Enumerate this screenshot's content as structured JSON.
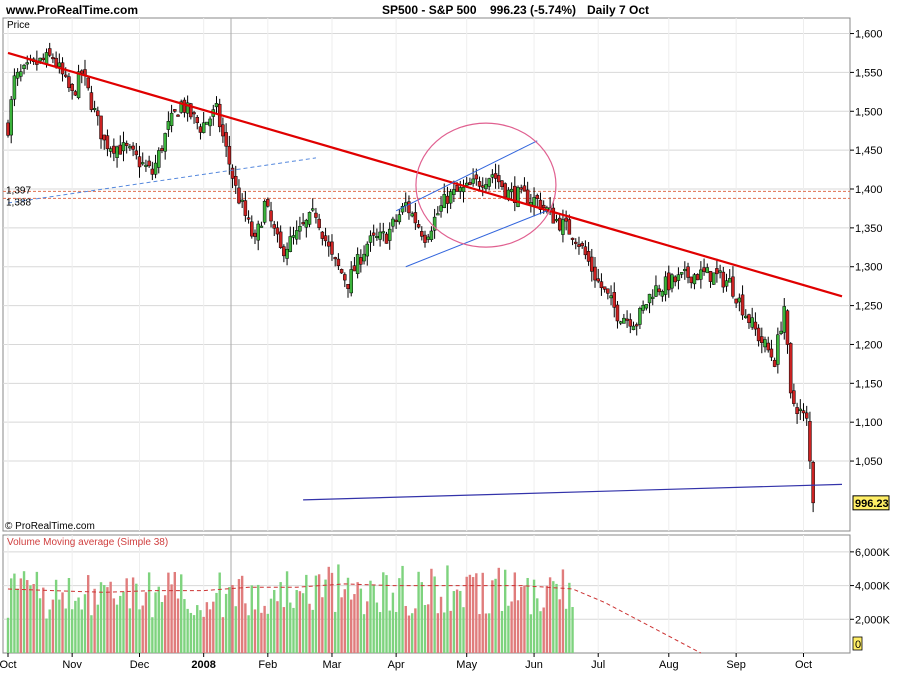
{
  "header": {
    "site": "www.ProRealTime.com",
    "title": "SP500 - S&P 500",
    "last": "996.23 (-5.74%)",
    "period": "Daily  7 Oct"
  },
  "price_panel": {
    "label": "Price",
    "copyright": "© ProRealTime.com",
    "last_price_tag": "996.23",
    "hline_labels": [
      "1,397",
      "1,388"
    ]
  },
  "volume_panel": {
    "label": "Volume Moving average (Simple 38)"
  },
  "colors": {
    "up": "#3bb33b",
    "down": "#cc2222",
    "vol_up": "#7ed37e",
    "vol_down": "#e07c7c",
    "trend_red": "#e00000",
    "channel_blue": "#3366dd",
    "support_blue": "#3333aa",
    "circle": "#e06090",
    "grid": "#d8d8d8",
    "hline": "#e07050",
    "tag_bg": "#ffee66"
  },
  "chart_data": {
    "type": "candlestick",
    "title": "SP500 - S&P 500",
    "ylim": [
      960,
      1620
    ],
    "y_ticks": [
      1050,
      1100,
      1150,
      1200,
      1250,
      1300,
      1350,
      1400,
      1450,
      1500,
      1550,
      1600
    ],
    "y_tick_labels": [
      "1,050",
      "1,100",
      "1,150",
      "1,200",
      "1,250",
      "1,300",
      "1,350",
      "1,400",
      "1,450",
      "1,500",
      "1,550",
      "1,600"
    ],
    "x_labels": [
      "Oct",
      "Nov",
      "Dec",
      "2008",
      "Feb",
      "Mar",
      "Apr",
      "May",
      "Jun",
      "Jul",
      "Aug",
      "Sep",
      "Oct"
    ],
    "x_label_days": [
      0,
      20,
      41,
      61,
      81,
      101,
      121,
      143,
      164,
      184,
      206,
      227,
      248
    ],
    "total_days": 260,
    "close_anchors": [
      [
        0,
        1480
      ],
      [
        2,
        1540
      ],
      [
        8,
        1560
      ],
      [
        14,
        1570
      ],
      [
        20,
        1520
      ],
      [
        23,
        1550
      ],
      [
        30,
        1460
      ],
      [
        37,
        1450
      ],
      [
        45,
        1420
      ],
      [
        50,
        1480
      ],
      [
        54,
        1510
      ],
      [
        60,
        1480
      ],
      [
        65,
        1500
      ],
      [
        71,
        1400
      ],
      [
        77,
        1330
      ],
      [
        80,
        1380
      ],
      [
        85,
        1320
      ],
      [
        90,
        1340
      ],
      [
        96,
        1370
      ],
      [
        101,
        1310
      ],
      [
        106,
        1280
      ],
      [
        112,
        1330
      ],
      [
        118,
        1340
      ],
      [
        124,
        1380
      ],
      [
        130,
        1340
      ],
      [
        137,
        1390
      ],
      [
        143,
        1400
      ],
      [
        151,
        1420
      ],
      [
        156,
        1395
      ],
      [
        161,
        1390
      ],
      [
        165,
        1385
      ],
      [
        171,
        1360
      ],
      [
        177,
        1340
      ],
      [
        184,
        1280
      ],
      [
        190,
        1240
      ],
      [
        196,
        1230
      ],
      [
        201,
        1270
      ],
      [
        207,
        1280
      ],
      [
        213,
        1290
      ],
      [
        219,
        1290
      ],
      [
        225,
        1280
      ],
      [
        230,
        1240
      ],
      [
        234,
        1210
      ],
      [
        239,
        1180
      ],
      [
        242,
        1250
      ],
      [
        244,
        1130
      ],
      [
        246,
        1120
      ],
      [
        249,
        1100
      ],
      [
        251,
        996
      ]
    ],
    "last_close": 996.23,
    "annotations": {
      "resistance_line": [
        [
          0,
          1575
        ],
        [
          260,
          1262
        ]
      ],
      "support_line": [
        [
          92,
          1000
        ],
        [
          260,
          1020
        ]
      ],
      "channel_upper": [
        [
          121,
          1372
        ],
        [
          165,
          1462
        ]
      ],
      "channel_lower": [
        [
          124,
          1300
        ],
        [
          168,
          1372
        ]
      ],
      "dashed_trend": [
        [
          0,
          1382
        ],
        [
          96,
          1440
        ]
      ],
      "hlines": [
        1397,
        1388
      ]
    },
    "volume": {
      "ylim": [
        0,
        7000
      ],
      "y_ticks": [
        2000,
        4000,
        6000
      ],
      "y_tick_labels": [
        "2,000K",
        "4,000K",
        "6,000K"
      ],
      "bottom_tag": "0",
      "vol_end_day": 176,
      "ma_anchors": [
        [
          0,
          3800
        ],
        [
          14,
          3700
        ],
        [
          30,
          3600
        ],
        [
          45,
          3700
        ],
        [
          61,
          3700
        ],
        [
          75,
          3900
        ],
        [
          90,
          3900
        ],
        [
          105,
          4100
        ],
        [
          120,
          4000
        ],
        [
          140,
          4000
        ],
        [
          160,
          4000
        ],
        [
          176,
          3800
        ],
        [
          186,
          3000
        ],
        [
          200,
          1600
        ],
        [
          216,
          0
        ]
      ]
    }
  }
}
